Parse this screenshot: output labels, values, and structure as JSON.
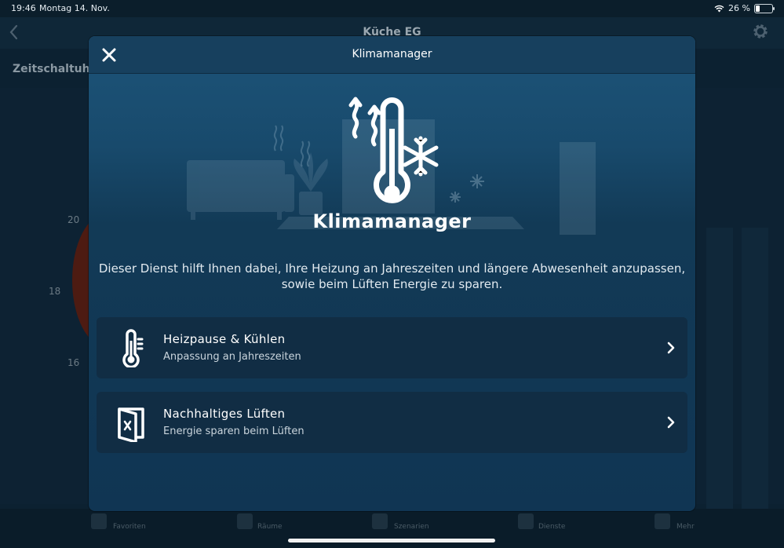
{
  "status_bar": {
    "time": "19:46",
    "date": "Montag 14. Nov.",
    "battery_text": "26 %",
    "battery_level": 0.26
  },
  "background": {
    "title": "Küche EG",
    "subtitle": "Zeitschaltuhr",
    "ticks": [
      "20",
      "18",
      "16"
    ],
    "tabs": [
      "Favoriten",
      "Räume",
      "Szenarien",
      "Dienste",
      "Mehr"
    ]
  },
  "modal": {
    "title": "Klimamanager",
    "hero_title": "Klimamanager",
    "description": "Dieser Dienst hilft Ihnen dabei, Ihre Heizung an Jahreszeiten und längere Abwesenheit anzupassen, sowie beim Lüften Energie zu sparen.",
    "services": [
      {
        "title": "Heizpause & Kühlen",
        "subtitle": "Anpassung an Jahreszeiten",
        "icon": "thermometer-icon"
      },
      {
        "title": "Nachhaltiges Lüften",
        "subtitle": "Energie sparen beim Lüften",
        "icon": "window-icon"
      }
    ]
  },
  "colors": {
    "modal_top": "#1d5479",
    "modal_bottom": "#103553",
    "card": "#112d44",
    "accent_text": "#ffffff"
  }
}
